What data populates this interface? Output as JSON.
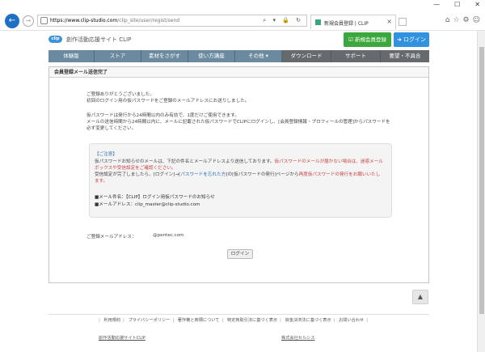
{
  "window": {
    "minimize": "—",
    "maximize": "☐",
    "close": "✕"
  },
  "browser": {
    "back_icon": "←",
    "forward_icon": "→",
    "url_host": "https://www.clip-studio.com",
    "url_path": "/clip_site/user/regist/send",
    "addr_icons": "⌕ ▾ 🔒 ↻",
    "tab_title": "新規会員登録 | CLIP",
    "tab_close": "×",
    "icons": [
      "⌂",
      "☆",
      "⚙",
      "☺"
    ]
  },
  "header": {
    "logo": "clip",
    "site_title": "創作活動応援サイト CLIP",
    "register_button": "☑ 新規会員登録",
    "login_button": "➜ ログイン"
  },
  "nav": {
    "items": [
      {
        "label": "体験版",
        "style": "blue"
      },
      {
        "label": "ストア",
        "style": "blue"
      },
      {
        "label": "素材をさがす",
        "style": "blue"
      },
      {
        "label": "使い方講座",
        "style": "blue"
      },
      {
        "label": "その他 ▾",
        "style": "blue"
      },
      {
        "label": "ダウンロード",
        "style": "gray"
      },
      {
        "label": "サポート",
        "style": "gray"
      },
      {
        "label": "要望・不具合",
        "style": "gray"
      }
    ]
  },
  "panel": {
    "heading": "会員登録メール送信完了",
    "intro_1": "ご登録ありがとうございました。",
    "intro_2": "初回のログイン用の仮パスワードをご登録のメールアドレスにお送りしました。",
    "info_1": "仮パスワードは発行から24時間以内のみ有効で、1度だけご使用できます。",
    "info_2": "メールの送信時間から24時間以内に、メールに記載された仮パスワードでCLIPにログインし、[会員登録情報・プロフィールの管理]からパスワードを",
    "info_3": "必ず変更してください。",
    "notice": {
      "title": "【ご注意】",
      "line_1a": "仮パスワードお知らせのメールは、下記の件名とメールアドレスより送信しております。",
      "line_1b": "仮パスワードのメールが届かない場合は、迷惑メール",
      "line_2": "ボックスや受信設定をご確認ください。",
      "line_3a": "受信設定が完了しましたら、[ログイン]→[",
      "line_3_link": "パスワードを忘れた方",
      "line_3b": "]の[仮パスワードの発行]ページから",
      "line_3c": "再度仮パスワードの発行をお願いいたし",
      "line_4": "ます。",
      "mail_subject": "■メール件名：【CLIP】ログイン用仮パスワードのお知らせ",
      "mail_address": "■メールアドレス：clip_master@clip-studio.com"
    },
    "registered_mail_label": "ご登録メールアドレス：",
    "registered_mail_value": "@pentec.com",
    "login_button": "ログイン"
  },
  "to_top": "▲",
  "footer": {
    "links": [
      "利用規約",
      "プライバシーポリシー",
      "著作権と商標について",
      "特定商取引法に基づく表示",
      "資金決済法に基づく表示",
      "お問い合わせ"
    ],
    "brand_1": "創作活動応援サイトCLIP",
    "brand_2": "株式会社セルシス"
  }
}
